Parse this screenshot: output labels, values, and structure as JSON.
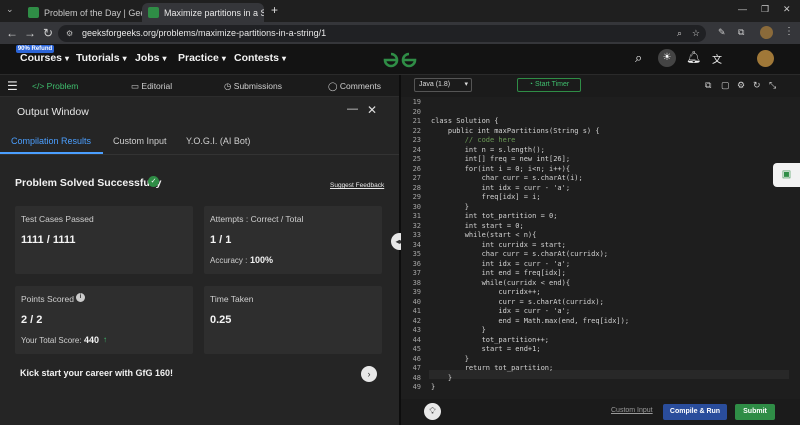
{
  "browser": {
    "tabs": [
      {
        "title": "Problem of the Day | GeeksforG",
        "active": false
      },
      {
        "title": "Maximize partitions in a String |",
        "active": true
      }
    ],
    "url": "geeksforgeeks.org/problems/maximize-partitions-in-a-string/1",
    "new_tab": "+"
  },
  "header": {
    "promo_badge": "90% Refund",
    "menus": [
      "Courses",
      "Tutorials",
      "Jobs",
      "Practice",
      "Contests"
    ],
    "logo": "GfG",
    "accent": "#2f8d46"
  },
  "left_tabs": [
    "Problem",
    "Editorial",
    "Submissions",
    "Comments"
  ],
  "output_window": {
    "title": "Output Window",
    "tabs": [
      "Compilation Results",
      "Custom Input",
      "Y.O.G.I. (AI Bot)"
    ],
    "status": "Problem Solved Successfully",
    "suggest_feedback": "Suggest Feedback",
    "test_cases_label": "Test Cases Passed",
    "test_cases_value": "1111 / 1111",
    "attempts_label": "Attempts : Correct / Total",
    "attempts_value": "1 / 1",
    "accuracy_label": "Accuracy :",
    "accuracy_value": "100%",
    "points_label": "Points Scored",
    "points_value": "2 / 2",
    "total_score_label": "Your Total Score:",
    "total_score_value": "440",
    "time_label": "Time Taken",
    "time_value": "0.25",
    "career_text": "Kick start your career with GfG 160!"
  },
  "editor": {
    "language": "Java (1.8)",
    "timer_label": "Start Timer",
    "lines": [
      {
        "n": "19",
        "t": ""
      },
      {
        "n": "20",
        "t": ""
      },
      {
        "n": "21",
        "t": "class Solution {"
      },
      {
        "n": "22",
        "t": "    public int maxPartitions(String s) {"
      },
      {
        "n": "23",
        "t": "        // code here"
      },
      {
        "n": "24",
        "t": "        int n = s.length();"
      },
      {
        "n": "25",
        "t": "        int[] freq = new int[26];"
      },
      {
        "n": "26",
        "t": "        for(int i = 0; i<n; i++){"
      },
      {
        "n": "27",
        "t": "            char curr = s.charAt(i);"
      },
      {
        "n": "28",
        "t": "            int idx = curr - 'a';"
      },
      {
        "n": "29",
        "t": "            freq[idx] = i;"
      },
      {
        "n": "30",
        "t": "        }"
      },
      {
        "n": "31",
        "t": "        int tot_partition = 0;"
      },
      {
        "n": "32",
        "t": "        int start = 0;"
      },
      {
        "n": "33",
        "t": "        while(start < n){"
      },
      {
        "n": "34",
        "t": "            int curridx = start;"
      },
      {
        "n": "35",
        "t": "            char curr = s.charAt(curridx);"
      },
      {
        "n": "36",
        "t": "            int idx = curr - 'a';"
      },
      {
        "n": "37",
        "t": "            int end = freq[idx];"
      },
      {
        "n": "38",
        "t": "            while(curridx < end){"
      },
      {
        "n": "39",
        "t": "                curridx++;"
      },
      {
        "n": "40",
        "t": "                curr = s.charAt(curridx);"
      },
      {
        "n": "41",
        "t": "                idx = curr - 'a';"
      },
      {
        "n": "42",
        "t": "                end = Math.max(end, freq[idx]);"
      },
      {
        "n": "43",
        "t": "            }"
      },
      {
        "n": "44",
        "t": "            tot_partition++;"
      },
      {
        "n": "45",
        "t": "            start = end+1;"
      },
      {
        "n": "46",
        "t": "        }"
      },
      {
        "n": "47",
        "t": "        return tot_partition;"
      },
      {
        "n": "48",
        "t": "    }"
      },
      {
        "n": "49",
        "t": "}"
      }
    ],
    "custom_input": "Custom Input",
    "compile_run": "Compile & Run",
    "submit": "Submit"
  }
}
